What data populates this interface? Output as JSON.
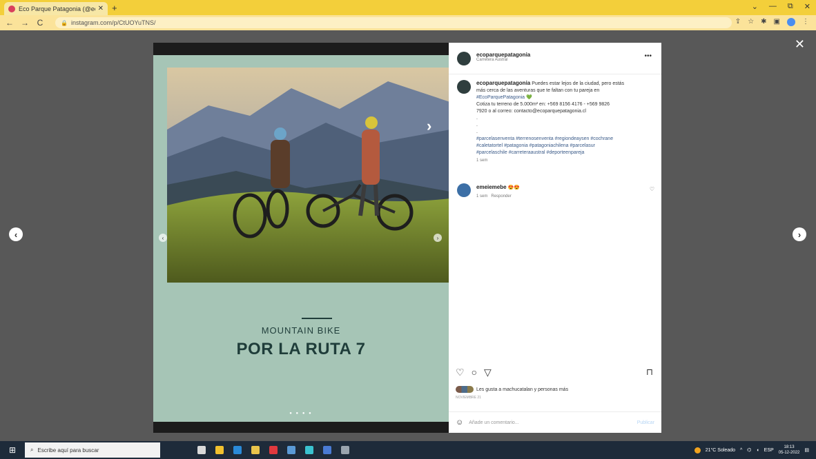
{
  "browser": {
    "tab_title": "Eco Parque Patagonia (@ecopar",
    "tab_close": "✕",
    "new_tab": "+",
    "url": "instagram.com/p/CtUOYuTNS/",
    "nav_back": "←",
    "nav_forward": "→",
    "nav_reload": "C",
    "win_min": "—",
    "win_max": "⧉",
    "win_close": "✕",
    "chevron": "⌄"
  },
  "viewer": {
    "close": "✕",
    "prev": "‹",
    "next": "›"
  },
  "post_image": {
    "caption_small": "MOUNTAIN BIKE",
    "caption_big": "POR LA RUTA 7",
    "next_arrow": "›",
    "mini_prev": "‹",
    "mini_next": "›",
    "dots": "● ● ● ●"
  },
  "panel": {
    "author": "ecoparquepatagonia",
    "location": "Carretera Austral",
    "more": "•••",
    "caption_author": "ecoparquepatagonia",
    "caption_lines": [
      "Puedes estar lejos de la ciudad, pero estás",
      "más cerca de las aventuras que te faltan con tu pareja en",
      "#EcoParquePatagonia 💚",
      "Cotiza tu terreno de 5.000m² en: +569 8156 4176 - +569 9826",
      "7920 o al correo: contacto@ecoparquepatagonia.cl",
      ".",
      ".",
      ".",
      "#parcelasenventa #terrenosenventa #regiondeaysen #cochrane",
      "#caletatortel #patagonia #patagoniachilena #parcelasur",
      "#parcelaschile #carreteraaustral #deporteenpareja"
    ],
    "caption_time": "1 sem",
    "comment_user": "emeiemebe",
    "comment_text": "😍😍",
    "comment_time": "1 sem",
    "comment_reply": "Responder",
    "comment_heart": "♡",
    "action_like": "♡",
    "action_comment": "○",
    "action_share": "▽",
    "action_save": "⊓",
    "likes_text": "Les gusta a machucatalan y personas más",
    "date": "NOVIEMBRE 21",
    "add_comment_placeholder": "Añade un comentario...",
    "publish": "Publicar",
    "emoji_icon": "☺"
  },
  "taskbar": {
    "search_placeholder": "Escribe aquí para buscar",
    "weather": "21°C Soleado",
    "lang": "ESP",
    "time": "18:13",
    "date": "05-12-2022"
  }
}
